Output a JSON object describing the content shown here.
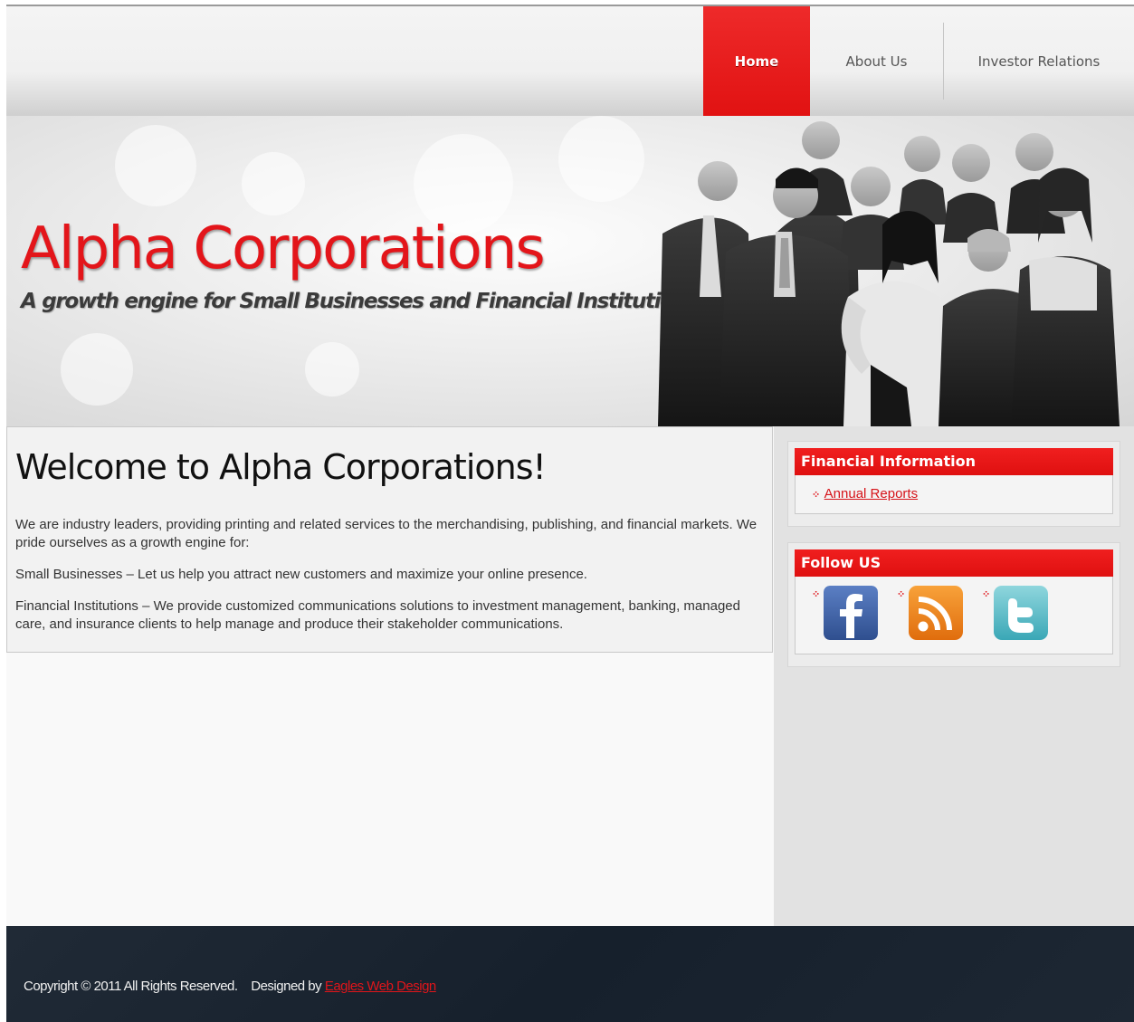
{
  "nav": {
    "items": [
      {
        "label": "Home"
      },
      {
        "label": "About Us"
      },
      {
        "label": "Investor Relations"
      }
    ]
  },
  "banner": {
    "title": "Alpha Corporations",
    "tagline": "A growth engine for Small Businesses and Financial Institutions"
  },
  "welcome": {
    "title": "Welcome to Alpha Corporations!",
    "paragraphs": [
      "We are industry leaders, providing printing and related services to the merchandising, publishing, and financial markets. We pride ourselves as a growth engine for:",
      "Small Businesses – Let us help you attract new customers and maximize your online presence.",
      "Financial Institutions – We provide customized communications solutions to investment management, banking, managed care, and insurance clients to help manage and produce their stakeholder communications."
    ]
  },
  "sidebar": {
    "financial": {
      "title": "Financial Information",
      "link": "Annual Reports"
    },
    "follow": {
      "title": "Follow US",
      "icons": [
        "facebook-icon",
        "rss-icon",
        "twitter-icon"
      ]
    }
  },
  "footer": {
    "copyright": "Copyright © 2011 All Rights Reserved.",
    "designed_by": "Designed by",
    "designer_link": "Eagles Web Design"
  },
  "colors": {
    "accent": "#e3151a",
    "footer_bg": "#1c2531"
  }
}
